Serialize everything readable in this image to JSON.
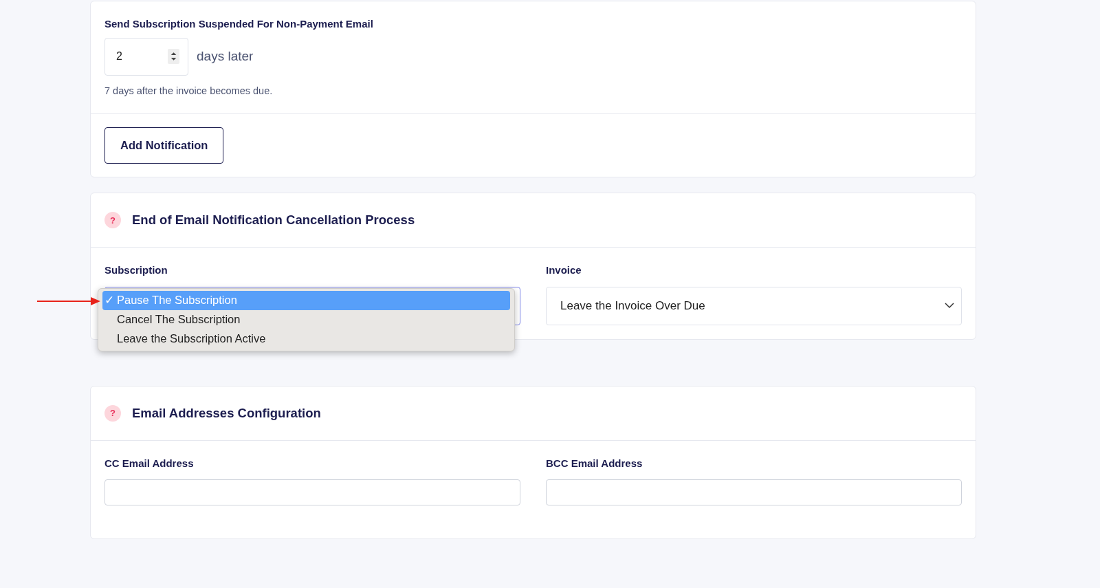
{
  "notification_card": {
    "label": "Send Subscription Suspended For Non-Payment Email",
    "days": "2",
    "unit": "days later",
    "help": "7 days after the invoice becomes due.",
    "add_button": "Add Notification"
  },
  "cancellation": {
    "title": "End of Email Notification Cancellation Process",
    "help_icon": "?",
    "subscription": {
      "label": "Subscription",
      "open": true,
      "check_mark": "✓",
      "options": [
        {
          "label": "Pause The Subscription",
          "selected": true
        },
        {
          "label": "Cancel The Subscription",
          "selected": false
        },
        {
          "label": "Leave the Subscription Active",
          "selected": false
        }
      ]
    },
    "invoice": {
      "label": "Invoice",
      "value": "Leave the Invoice Over Due"
    }
  },
  "email_config": {
    "title": "Email Addresses Configuration",
    "help_icon": "?",
    "cc": {
      "label": "CC Email Address"
    },
    "bcc": {
      "label": "BCC Email Address"
    }
  }
}
